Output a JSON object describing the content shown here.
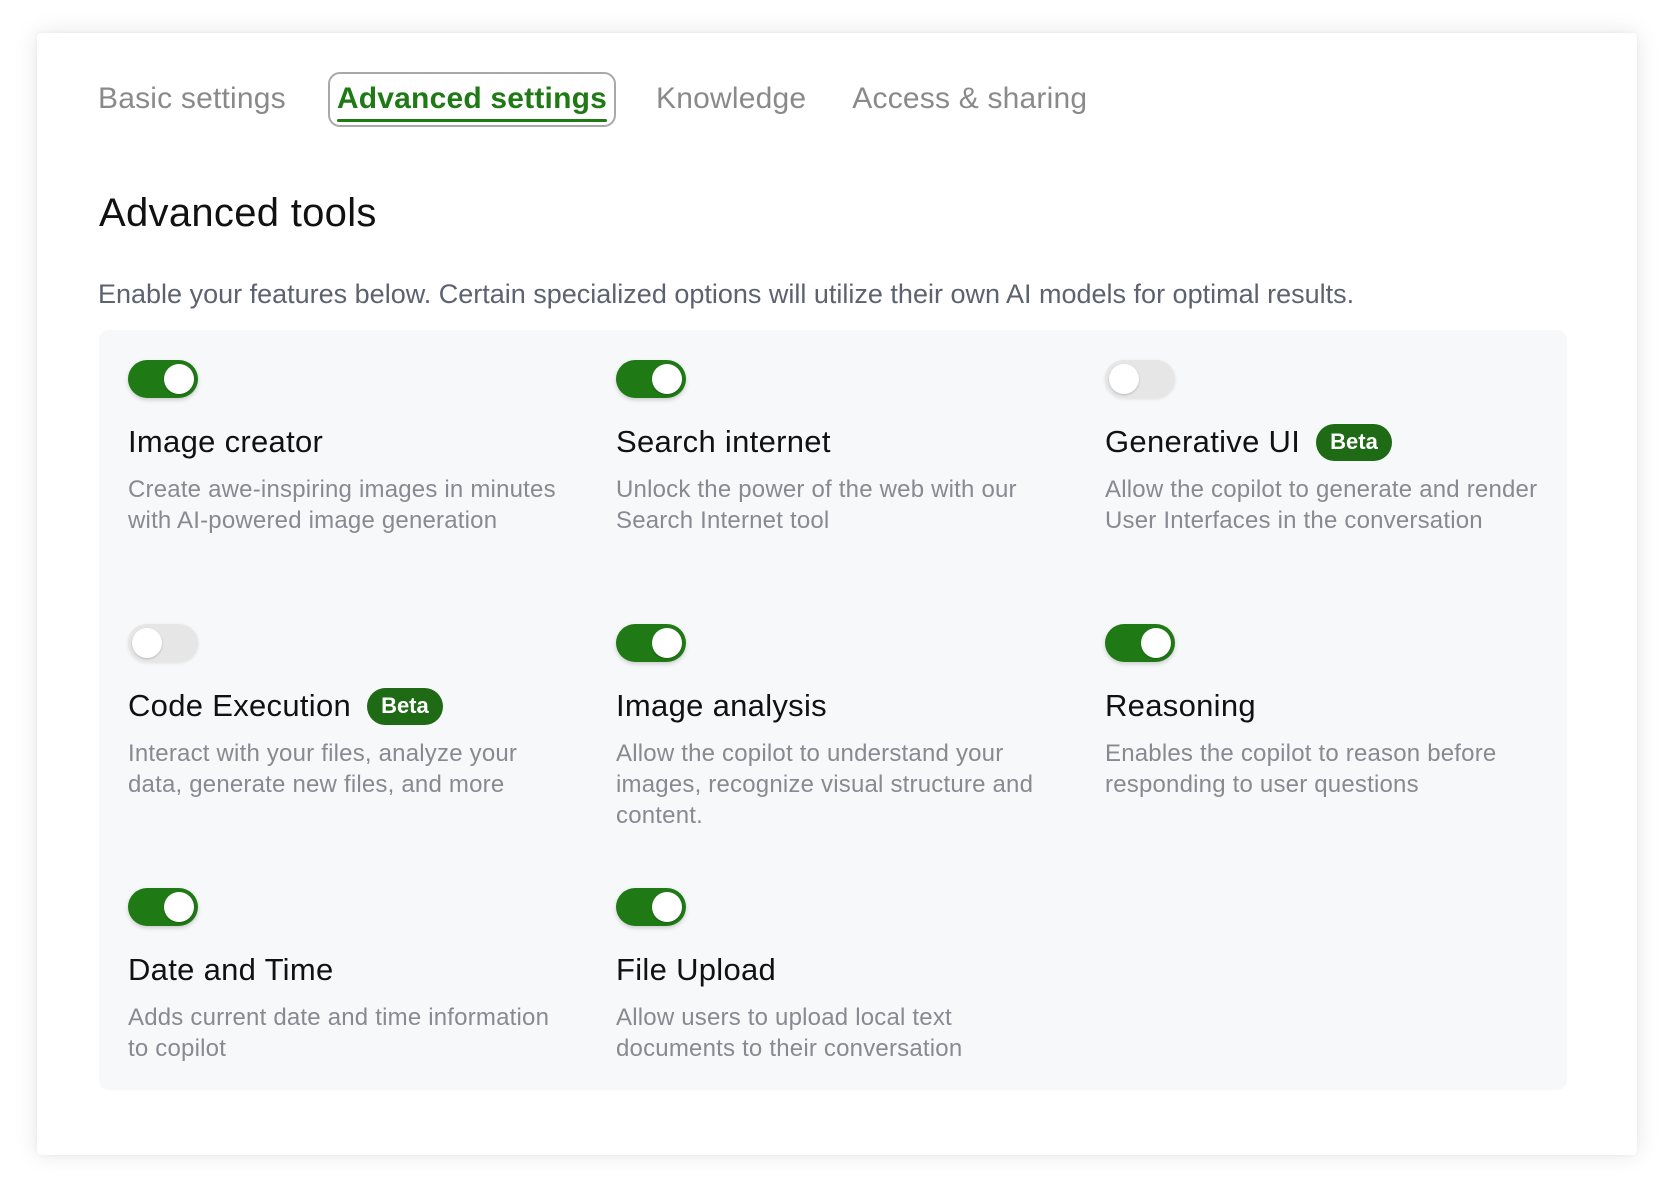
{
  "tabs": [
    {
      "label": "Basic settings",
      "active": false
    },
    {
      "label": "Advanced settings",
      "active": true
    },
    {
      "label": "Knowledge",
      "active": false
    },
    {
      "label": "Access & sharing",
      "active": false
    }
  ],
  "section": {
    "title": "Advanced tools",
    "description": "Enable your features below. Certain specialized options will utilize their own AI models for optimal results."
  },
  "tools": [
    {
      "title": "Image creator",
      "description": "Create awe-inspiring images in minutes with AI-powered image generation",
      "enabled": true,
      "badge": ""
    },
    {
      "title": "Search internet",
      "description": "Unlock the power of the web with our Search Internet tool",
      "enabled": true,
      "badge": ""
    },
    {
      "title": "Generative UI",
      "description": "Allow the copilot to generate and render User Interfaces in the conversation",
      "enabled": false,
      "badge": "Beta"
    },
    {
      "title": "Code Execution",
      "description": "Interact with your files, analyze your data, generate new files, and more",
      "enabled": false,
      "badge": "Beta"
    },
    {
      "title": "Image analysis",
      "description": "Allow the copilot to understand your images, recognize visual structure and content.",
      "enabled": true,
      "badge": ""
    },
    {
      "title": "Reasoning",
      "description": "Enables the copilot to reason before responding to user questions",
      "enabled": true,
      "badge": ""
    },
    {
      "title": "Date and Time",
      "description": "Adds current date and time information to copilot",
      "enabled": true,
      "badge": ""
    },
    {
      "title": "File Upload",
      "description": "Allow users to upload local text documents to their conversation",
      "enabled": true,
      "badge": ""
    }
  ],
  "colors": {
    "accent": "#1f7a16",
    "toggle_off": "#e6e6e6",
    "badge_bg": "#1f6a14"
  }
}
